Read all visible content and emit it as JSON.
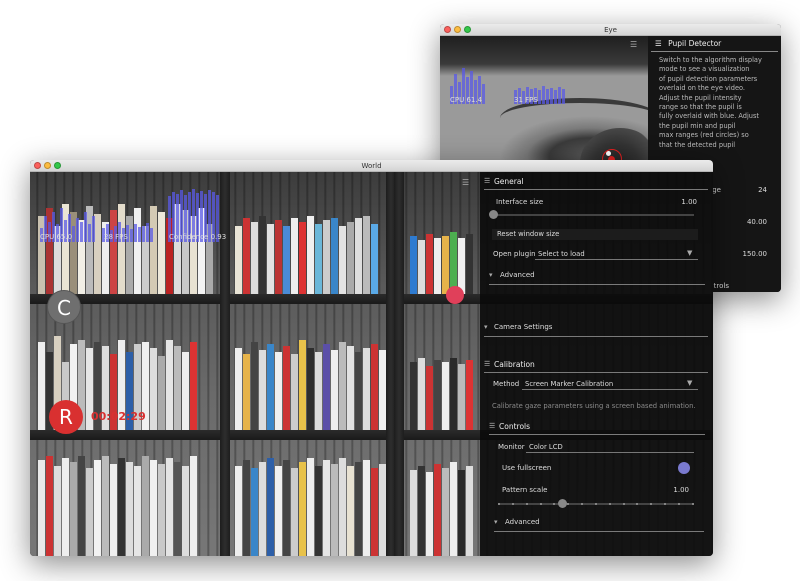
{
  "eye_window": {
    "title": "Eye",
    "cpu_label": "CPU 61.4",
    "fps_label": "31 FPS",
    "panel_title": "Pupil Detector",
    "description_lines": [
      "Switch to the algorithm display",
      "mode to see a visualization",
      "of pupil detection parameters",
      "overlaid on the eye video.",
      "Adjust the pupil intensity",
      "range so that the pupil is",
      "fully overlaid with blue. Adjust",
      "the pupil min and pupil",
      "max ranges (red circles) so",
      "that the detected pupil"
    ],
    "row_range_label": "ange",
    "row_range_value": "24",
    "row_min_value": "40.00",
    "row_max_value": "150.00",
    "row_controls_label": "trols",
    "menu_icon": "menu-icon"
  },
  "world_window": {
    "title": "World",
    "cpu_label": "CPU 65.0",
    "fps_label": "28 FPS",
    "confidence_label": "Confidence 0.93",
    "calibrate_button": "C",
    "record_button": "R",
    "record_timer": "00:02:29",
    "panel": {
      "general_title": "General",
      "interface_size_label": "Interface size",
      "interface_size_value": "1.00",
      "reset_window_size": "Reset window size",
      "open_plugin_label": "Open plugin",
      "open_plugin_value": "Select to load",
      "advanced_label": "Advanced",
      "camera_settings_label": "Camera Settings",
      "calibration_title": "Calibration",
      "method_label": "Method",
      "method_value": "Screen Marker Calibration",
      "calibration_desc": "Calibrate gaze parameters using a screen based animation.",
      "controls_title": "Controls",
      "monitor_label": "Monitor",
      "monitor_value": "Color LCD",
      "use_fullscreen_label": "Use fullscreen",
      "pattern_scale_label": "Pattern scale",
      "pattern_scale_value": "1.00",
      "advanced2_label": "Advanced"
    }
  },
  "colors": {
    "graph_bar": "#5a5ae6",
    "record_red": "#d93030",
    "calibrate_grey": "#6f6f6f",
    "toggle_on": "#7a7acf",
    "marker_pink": "#e0405a"
  },
  "icons": [
    "menu-icon",
    "chevron-down-icon",
    "window-close-light",
    "window-minimize-light",
    "window-zoom-light"
  ]
}
